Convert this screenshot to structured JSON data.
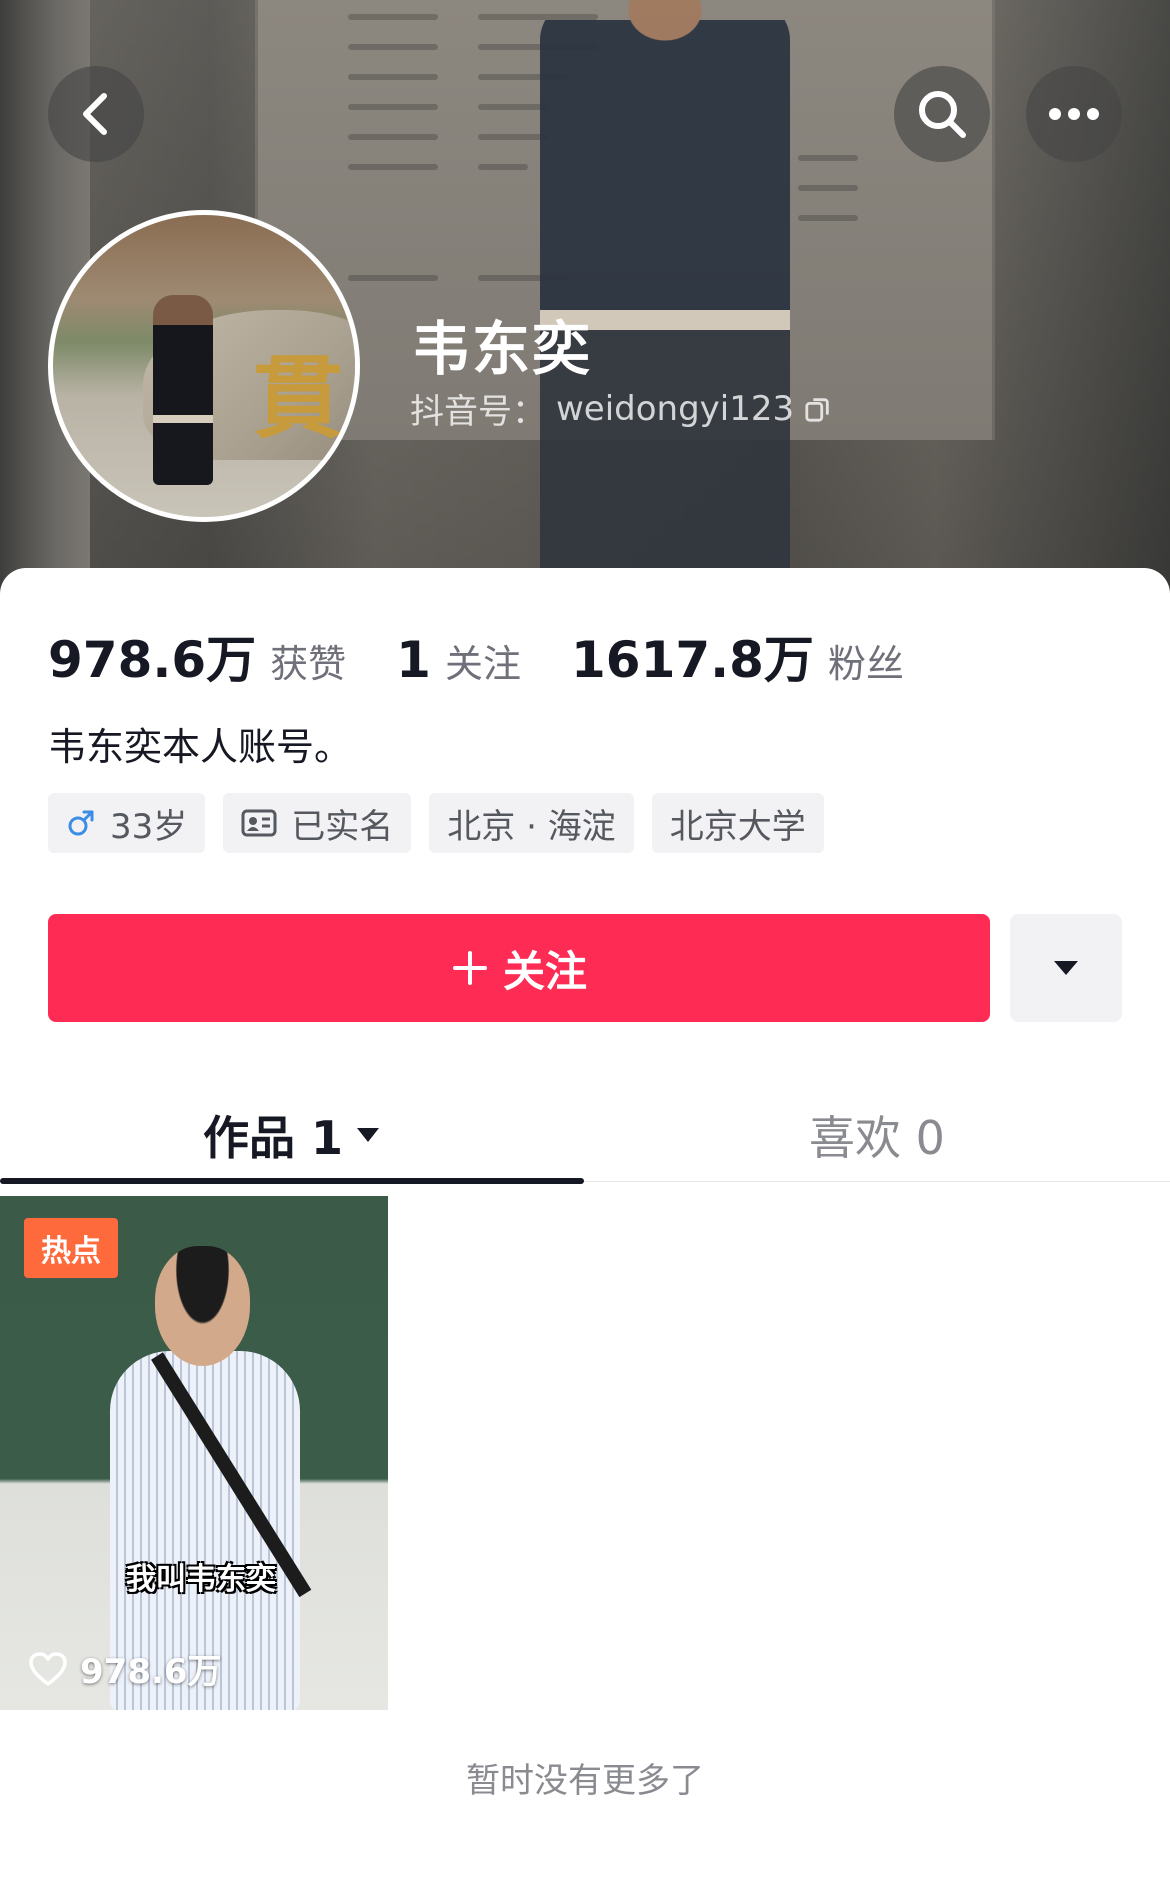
{
  "header": {
    "profile_name": "韦东奕",
    "douyin_id_label": "抖音号：",
    "douyin_id_value": "weidongyi123"
  },
  "icons": {
    "back": "back-icon",
    "search": "search-icon",
    "more": "more-icon",
    "copy": "copy-icon",
    "male": "male-icon",
    "id_card": "id-card-icon",
    "dropdown": "chevron-down-icon",
    "heart": "heart-icon"
  },
  "stats": [
    {
      "value": "978.6万",
      "label": "获赞"
    },
    {
      "value": "1",
      "label": "关注"
    },
    {
      "value": "1617.8万",
      "label": "粉丝"
    }
  ],
  "bio": "韦东奕本人账号。",
  "tags": {
    "age": "33岁",
    "verified": "已实名",
    "location": "北京 · 海淀",
    "school": "北京大学"
  },
  "actions": {
    "follow_label": "关注"
  },
  "tabs": {
    "works_label": "作品 1",
    "likes_label": "喜欢 0"
  },
  "videos": [
    {
      "badge": "热点",
      "caption": "我叫韦东奕",
      "likes": "978.6万"
    }
  ],
  "footer_note": "暂时没有更多了",
  "colors": {
    "accent": "#fe2c55",
    "hot_badge": "#ff6a3c",
    "male_icon": "#3a8ee6"
  }
}
